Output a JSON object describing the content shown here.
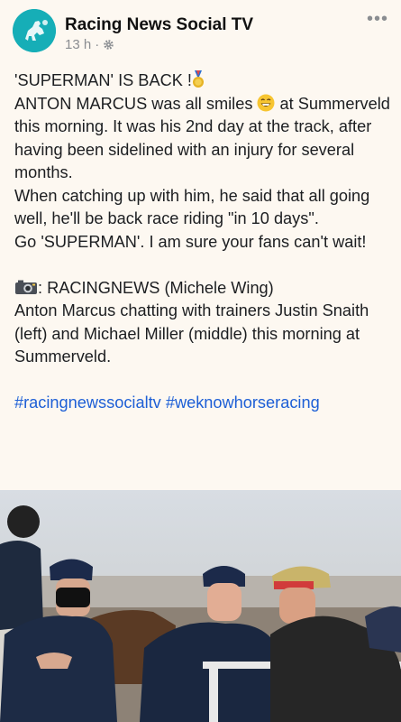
{
  "post": {
    "page_name": "Racing News Social TV",
    "time": "13 h",
    "separator": "·",
    "more_label": "•••",
    "lines": {
      "l1": "'SUPERMAN' IS BACK !",
      "l2a": "ANTON MARCUS was all smiles ",
      "l2b": " at",
      "l3": "Summerveld this morning. It was his 2nd day at the track, after having been sidelined with an injury for several months.",
      "l4": "When catching up with him, he said that all going well, he'll be back race riding \"in 10 days\".",
      "l5": "Go 'SUPERMAN'. I am sure your fans can't wait!",
      "credit": ": RACINGNEWS (Michele Wing)",
      "caption": "Anton Marcus chatting with trainers Justin Snaith (left) and Michael Miller (middle) this morning at Summerveld."
    },
    "hashtags": [
      "#racingnewssocialtv",
      "#weknowhorseracing"
    ]
  },
  "icons": {
    "avatar": "horse-logo-icon",
    "privacy": "gear-icon",
    "medal": "medal-icon",
    "smiley": "grinning-face-icon",
    "camera": "camera-icon"
  },
  "colors": {
    "avatar_bg": "#16aeb7",
    "hashtag": "#1d5fd6",
    "meta": "#8a8d91"
  }
}
